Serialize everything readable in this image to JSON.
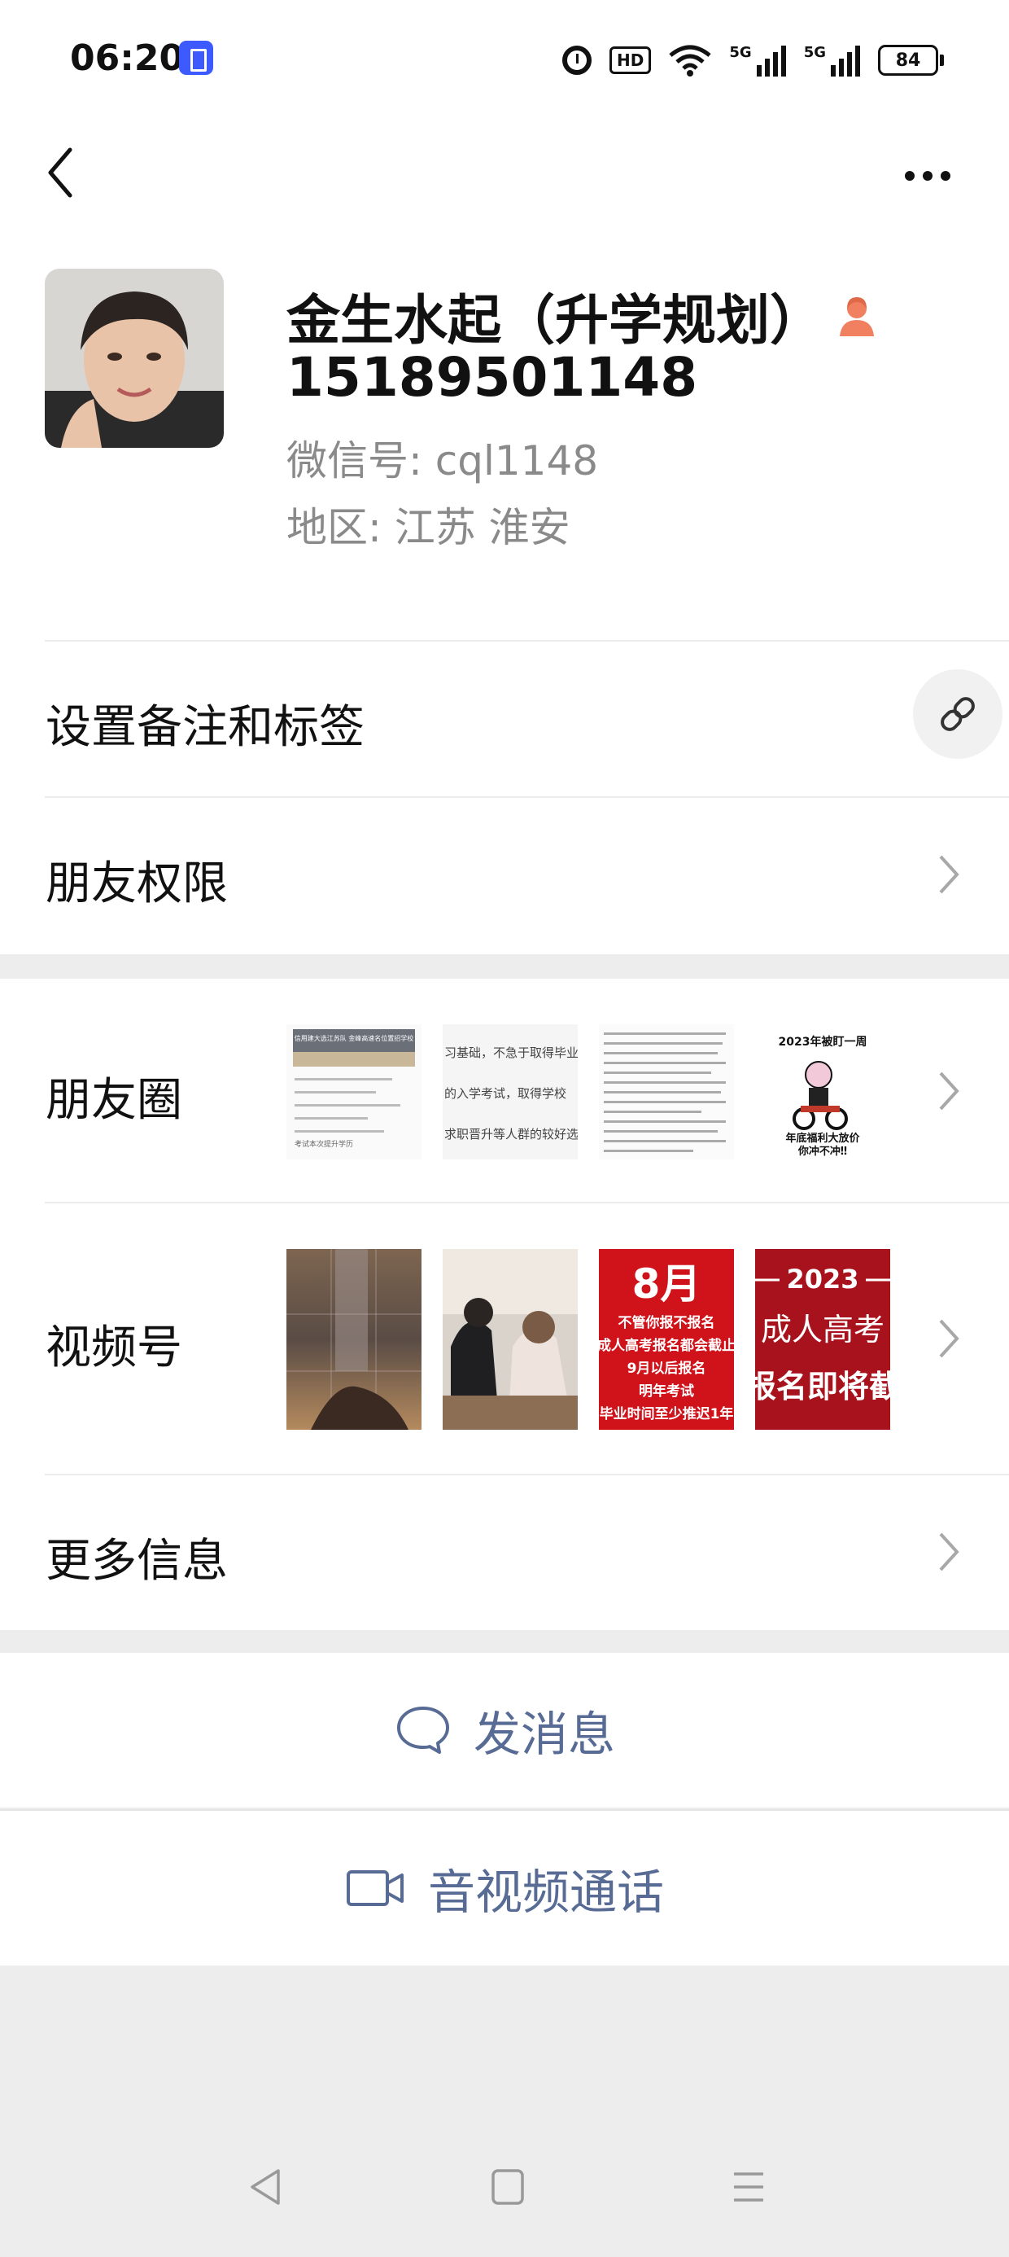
{
  "status_bar": {
    "time": "06:20",
    "hd_label": "HD",
    "signal_label_1": "5G",
    "signal_label_2": "5G",
    "battery": "84"
  },
  "profile": {
    "name": "金生水起（升学规划）",
    "phone": "15189501148",
    "wechat_id": "微信号: cql1148",
    "region": "地区: 江苏  淮安"
  },
  "rows": {
    "remark": "设置备注和标签",
    "permissions": "朋友权限",
    "moments": "朋友圈",
    "channels": "视频号",
    "more_info": "更多信息"
  },
  "moments_thumbs": [
    {
      "title": "信用建大选江苏队 金峰高速名位置招学校",
      "lines": [
        "考试本次提升学历",
        "收入增加",
        "工作晋升"
      ]
    },
    {
      "title": "",
      "lines": [
        "习基础，不急于取得毕业",
        "的入学考试，取得学校",
        "求职晋升等人群的较好选"
      ]
    },
    {
      "title": "",
      "lines": [
        "问答基础题",
        "成人高考的招生对象",
        "学历提升"
      ]
    },
    {
      "title": "2023年被盯一周",
      "caption": "年底福利大放价",
      "caption2": "你冲不冲‼"
    }
  ],
  "channels_thumbs": [
    {
      "label": ""
    },
    {
      "label": ""
    },
    {
      "big": "8月",
      "lines": [
        "不管你报不报名",
        "成人高考报名都会截止",
        "9月以后报名",
        "明年考试",
        "毕业时间至少推迟1年"
      ]
    },
    {
      "year": "2023",
      "lines": [
        "成人高考",
        "报名即将截"
      ]
    }
  ],
  "actions": {
    "message": "发消息",
    "call": "音视频通话"
  },
  "colors": {
    "link_blue": "#576b95",
    "background": "#ededed",
    "red_poster": "#d0121b"
  }
}
